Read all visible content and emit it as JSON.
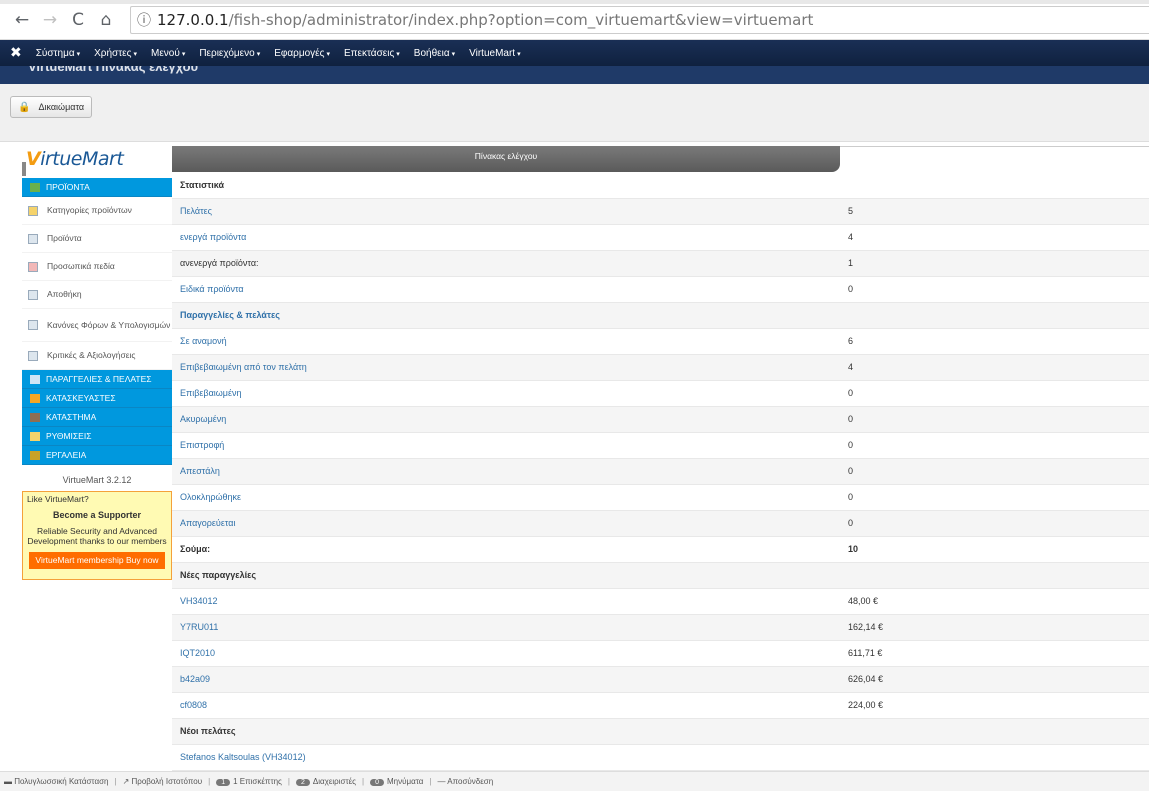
{
  "browser": {
    "url_host": "127.0.0.1",
    "url_path": "/fish-shop/administrator/index.php?option=com_virtuemart&view=virtuemart"
  },
  "topmenu": {
    "items": [
      "Σύστημα",
      "Χρήστες",
      "Μενού",
      "Περιεχόμενο",
      "Εφαρμογές",
      "Επεκτάσεις",
      "Βοήθεια",
      "VirtueMart"
    ]
  },
  "page_title": "VirtueMart Πίνακας ελέγχου",
  "toolbar": {
    "permissions_label": "Δικαιώματα"
  },
  "sidebar": {
    "logo_text": "VirtueMart",
    "sections": [
      "ΠΡΟΪΟΝΤΑ",
      "ΠΑΡΑΓΓΕΛΙΕΣ & ΠΕΛΑΤΕΣ",
      "ΚΑΤΑΣΚΕΥΑΣΤΕΣ",
      "ΚΑΤΑΣΤΗΜΑ",
      "ΡΥΘΜΙΣΕΙΣ",
      "ΕΡΓΑΛΕΙΑ"
    ],
    "product_links": [
      "Κατηγορίες προϊόντων",
      "Προϊόντα",
      "Προσωπικά πεδία",
      "Αποθήκη",
      "Κανόνες Φόρων & Υπολογισμών",
      "Κριτικές & Αξιολογήσεις"
    ],
    "version": "VirtueMart 3.2.12",
    "support": {
      "like": "Like VirtueMart?",
      "become": "Become a Supporter",
      "reliable": "Reliable Security and Advanced Development thanks to our members",
      "buy": "VirtueMart membership Buy now"
    }
  },
  "main": {
    "tab_label": "Πίνακας ελέγχου",
    "rows": [
      {
        "label": "Στατιστικά",
        "value": "",
        "type": "head"
      },
      {
        "label": "Πελάτες",
        "value": "5",
        "type": "link"
      },
      {
        "label": "ενεργά προϊόντα",
        "value": "4",
        "type": "link"
      },
      {
        "label": "ανενεργά προϊόντα:",
        "value": "1",
        "type": "text"
      },
      {
        "label": "Ειδικά προϊόντα",
        "value": "0",
        "type": "link"
      },
      {
        "label": "Παραγγελίες & πελάτες",
        "value": "",
        "type": "subhead"
      },
      {
        "label": "Σε αναμονή",
        "value": "6",
        "type": "link"
      },
      {
        "label": "Επιβεβαιωμένη από τον πελάτη",
        "value": "4",
        "type": "link"
      },
      {
        "label": "Επιβεβαιωμένη",
        "value": "0",
        "type": "link"
      },
      {
        "label": "Ακυρωμένη",
        "value": "0",
        "type": "link"
      },
      {
        "label": "Επιστροφή",
        "value": "0",
        "type": "link"
      },
      {
        "label": "Απεστάλη",
        "value": "0",
        "type": "link"
      },
      {
        "label": "Ολοκληρώθηκε",
        "value": "0",
        "type": "link"
      },
      {
        "label": "Απαγορεύεται",
        "value": "0",
        "type": "link"
      },
      {
        "label": "Σούμα:",
        "value": "10",
        "type": "total"
      },
      {
        "label": "Νέες παραγγελίες",
        "value": "",
        "type": "head"
      },
      {
        "label": "VH34012",
        "value": "48,00 €",
        "type": "link"
      },
      {
        "label": "Y7RU011",
        "value": "162,14 €",
        "type": "link"
      },
      {
        "label": "IQT2010",
        "value": "611,71 €",
        "type": "link"
      },
      {
        "label": "b42a09",
        "value": "626,04 €",
        "type": "link"
      },
      {
        "label": "cf0808",
        "value": "224,00 €",
        "type": "link"
      },
      {
        "label": "Νέοι πελάτες",
        "value": "",
        "type": "head"
      },
      {
        "label": "Stefanos Kaltsoulas (VH34012)",
        "value": "",
        "type": "link"
      }
    ]
  },
  "statusbar": {
    "multilang": "Πολυγλωσσική Κατάσταση",
    "view_site": "Προβολή Ιστοτόπου",
    "visitors_count": "1",
    "visitors_label": "1 Επισκέπτης",
    "admins_count": "2",
    "admins_label": "Διαχειριστές",
    "messages_count": "0",
    "messages_label": "Μηνύματα",
    "logout": "Αποσύνδεση"
  }
}
